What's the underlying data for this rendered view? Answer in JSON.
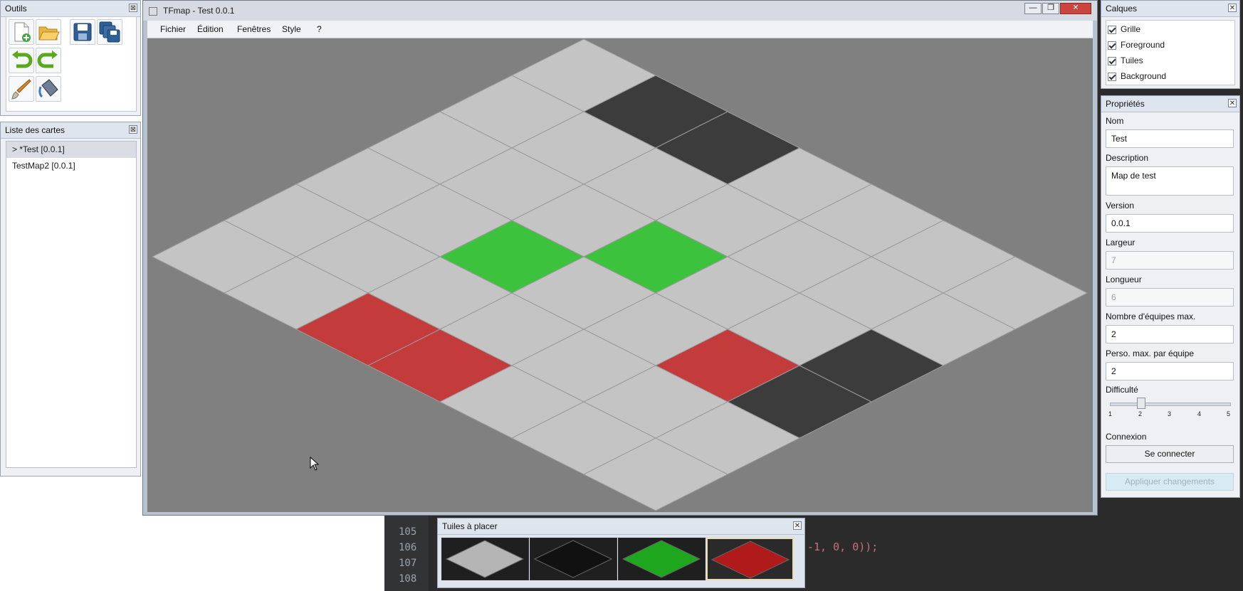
{
  "tools_panel": {
    "title": "Outils",
    "close": "⊠"
  },
  "maps_panel": {
    "title": "Liste des cartes",
    "close": "⊠",
    "items": [
      {
        "label": "> *Test  [0.0.1]"
      },
      {
        "label": "TestMap2  [0.0.1]"
      }
    ]
  },
  "main_window": {
    "title": "TFmap - Test 0.0.1",
    "menu": [
      "Fichier",
      "Édition",
      "Fenêtres",
      "Style",
      "?"
    ],
    "controls": {
      "minimize": "—",
      "maximize": "❐",
      "close": "✕"
    }
  },
  "layers_panel": {
    "title": "Calques",
    "close": "✕",
    "layers": [
      {
        "label": "Grille",
        "checked": true
      },
      {
        "label": "Foreground",
        "checked": true
      },
      {
        "label": "Tuiles",
        "checked": true
      },
      {
        "label": "Background",
        "checked": true
      }
    ]
  },
  "props_panel": {
    "title": "Propriétés",
    "close": "✕",
    "name_label": "Nom",
    "name_value": "Test",
    "description_label": "Description",
    "description_value": "Map de test",
    "version_label": "Version",
    "version_value": "0.0.1",
    "width_label": "Largeur",
    "width_value": "7",
    "length_label": "Longueur",
    "length_value": "6",
    "teams_label": "Nombre d'équipes max.",
    "teams_value": "2",
    "players_label": "Perso. max. par équipe",
    "players_value": "2",
    "difficulty_label": "Difficulté",
    "difficulty_ticks": [
      "1",
      "2",
      "3",
      "4",
      "5"
    ],
    "difficulty_value": 2,
    "connection_label": "Connexion",
    "connect_button": "Se connecter",
    "apply_button": "Appliquer changements"
  },
  "tiles_panel": {
    "title": "Tuiles à placer",
    "close": "✕",
    "tiles": [
      {
        "name": "light-grey",
        "color": "#b5b5b5"
      },
      {
        "name": "black",
        "color": "#111111"
      },
      {
        "name": "green",
        "color": "#1ea61e"
      },
      {
        "name": "red",
        "color": "#b01a1a",
        "selected": true
      }
    ]
  },
  "background_code": {
    "line_numbers": [
      "105",
      "106",
      "107",
      "108"
    ],
    "fragment": "-1, 0, 0));"
  },
  "map": {
    "cols": 7,
    "rows": 6,
    "colors": {
      "empty": "#c4c4c4",
      "dark": "#3c3c3c",
      "green": "#3cc23c",
      "red": "#c43b3b",
      "canvas_bg": "#808080"
    },
    "tiles": [
      [
        "empty",
        "empty",
        "empty",
        "empty",
        "empty",
        "empty"
      ],
      [
        "dark",
        "empty",
        "empty",
        "empty",
        "empty",
        "empty"
      ],
      [
        "dark",
        "empty",
        "empty",
        "green",
        "empty",
        "red"
      ],
      [
        "empty",
        "empty",
        "green",
        "empty",
        "empty",
        "red"
      ],
      [
        "empty",
        "empty",
        "empty",
        "empty",
        "empty",
        "empty"
      ],
      [
        "empty",
        "empty",
        "empty",
        "red",
        "empty",
        "empty"
      ],
      [
        "empty",
        "empty",
        "dark",
        "dark",
        "empty",
        "empty"
      ]
    ]
  }
}
